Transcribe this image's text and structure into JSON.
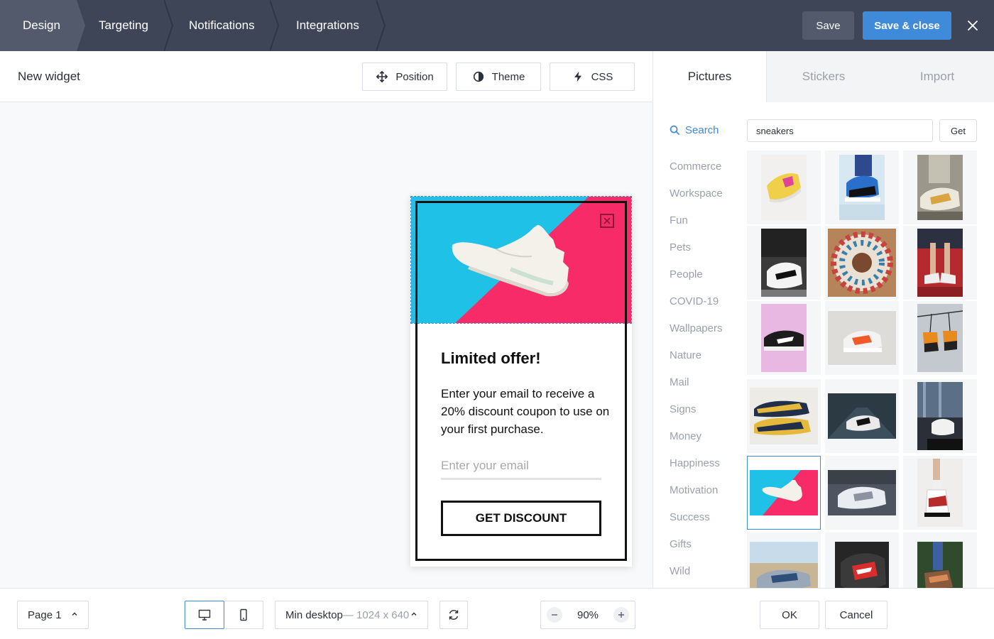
{
  "topbar": {
    "steps": [
      "Design",
      "Targeting",
      "Notifications",
      "Integrations"
    ],
    "save_label": "Save",
    "save_close_label": "Save & close"
  },
  "editor": {
    "title": "New widget",
    "tools": {
      "position": "Position",
      "theme": "Theme",
      "css": "CSS"
    }
  },
  "popup": {
    "title": "Limited offer!",
    "text": "Enter your email to receive a 20% discount coupon to use on your first purchase.",
    "email_placeholder": "Enter your email",
    "cta": "GET DISCOUNT",
    "colors": {
      "blue": "#1fc2e6",
      "pink": "#f72b68"
    }
  },
  "bottombar": {
    "page": "Page 1",
    "resolution_name": "Min desktop",
    "resolution_dim": "— 1024 x 640",
    "zoom": "90%",
    "ok": "OK",
    "cancel": "Cancel"
  },
  "panel": {
    "tabs": [
      "Pictures",
      "Stickers",
      "Import"
    ],
    "search_label": "Search",
    "search_value": "sneakers",
    "get_label": "Get",
    "categories": [
      "Commerce",
      "Workspace",
      "Fun",
      "Pets",
      "People",
      "COVID-19",
      "Wallpapers",
      "Nature",
      "Mail",
      "Signs",
      "Money",
      "Happiness",
      "Motivation",
      "Success",
      "Gifts",
      "Wild"
    ]
  },
  "colors": {
    "topbar": "#3d4557",
    "accent": "#3f8ad9"
  }
}
